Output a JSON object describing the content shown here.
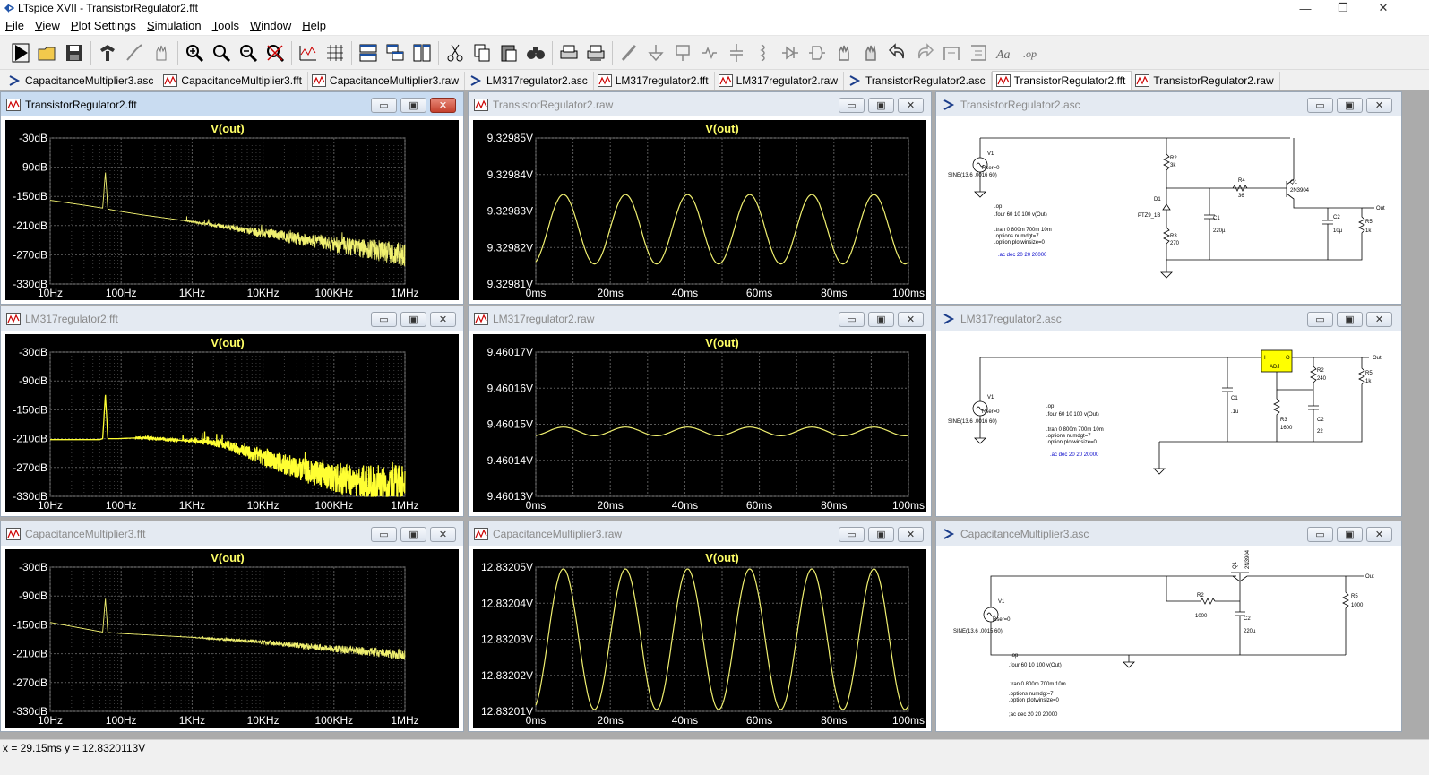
{
  "window": {
    "title": "LTspice XVII - TransistorRegulator2.fft",
    "minimize": "—",
    "maximize": "❐",
    "close": "✕"
  },
  "menu": [
    {
      "label": "File",
      "underline": "F",
      "rest": "ile"
    },
    {
      "label": "View",
      "underline": "V",
      "rest": "iew"
    },
    {
      "label": "Plot Settings",
      "underline": "P",
      "rest": "lot Settings"
    },
    {
      "label": "Simulation",
      "underline": "S",
      "rest": "imulation"
    },
    {
      "label": "Tools",
      "underline": "T",
      "rest": "ools"
    },
    {
      "label": "Window",
      "underline": "W",
      "rest": "indow"
    },
    {
      "label": "Help",
      "underline": "H",
      "rest": "elp"
    }
  ],
  "toolbar": [
    "run-icon",
    "open-icon",
    "save-icon",
    "control-panel-icon",
    "probe-icon",
    "pan-hand-icon",
    "zoom-in-icon",
    "zoom-box-icon",
    "zoom-out-icon",
    "zoom-fit-icon",
    "autorange-icon",
    "grid-icon",
    "tile-horizontal-icon",
    "cascade-icon",
    "tile-vertical-icon",
    "cut-icon",
    "copy-icon",
    "paste-icon",
    "find-icon",
    "print-icon",
    "print-setup-icon",
    "wire-icon",
    "ground-icon",
    "label-net-icon",
    "resistor-icon",
    "capacitor-icon",
    "inductor-icon",
    "diode-icon",
    "component-icon",
    "move-icon",
    "drag-icon",
    "undo-icon",
    "redo-icon",
    "rotate-icon",
    "mirror-icon",
    "text-icon",
    "spice-directive-icon"
  ],
  "tabs": [
    {
      "label": "CapacitanceMultiplier3.asc",
      "kind": "asc",
      "active": false
    },
    {
      "label": "CapacitanceMultiplier3.fft",
      "kind": "plot",
      "active": false
    },
    {
      "label": "CapacitanceMultiplier3.raw",
      "kind": "plot",
      "active": false
    },
    {
      "label": "LM317regulator2.asc",
      "kind": "asc",
      "active": false
    },
    {
      "label": "LM317regulator2.fft",
      "kind": "plot",
      "active": false
    },
    {
      "label": "LM317regulator2.raw",
      "kind": "plot",
      "active": false
    },
    {
      "label": "TransistorRegulator2.asc",
      "kind": "asc",
      "active": false
    },
    {
      "label": "TransistorRegulator2.fft",
      "kind": "plot",
      "active": true
    },
    {
      "label": "TransistorRegulator2.raw",
      "kind": "plot",
      "active": false
    }
  ],
  "windows": {
    "w11": {
      "title": "TransistorRegulator2.fft"
    },
    "w12": {
      "title": "TransistorRegulator2.raw"
    },
    "w13": {
      "title": "TransistorRegulator2.asc"
    },
    "w21": {
      "title": "LM317regulator2.fft"
    },
    "w22": {
      "title": "LM317regulator2.raw"
    },
    "w23": {
      "title": "LM317regulator2.asc"
    },
    "w31": {
      "title": "CapacitanceMultiplier3.fft"
    },
    "w32": {
      "title": "CapacitanceMultiplier3.raw"
    },
    "w33": {
      "title": "CapacitanceMultiplier3.asc"
    }
  },
  "colors": {
    "trace": "#f0f070",
    "trace_bright": "#ffff33",
    "grid": "#5a5a5a",
    "axis_text": "#ffffff",
    "trace_label": "#ffff66",
    "schematic_blue": "#0000c8"
  },
  "chart_data": [
    {
      "type": "line",
      "title": "V(out)",
      "window": "TransistorRegulator2.fft",
      "xscale": "log",
      "xlim": [
        "10Hz",
        "1MHz"
      ],
      "x_ticks": [
        "10Hz",
        "100Hz",
        "1KHz",
        "10KHz",
        "100KHz",
        "1MHz"
      ],
      "ylim": [
        -330,
        -30
      ],
      "y_ticks": [
        "-30dB",
        "-90dB",
        "-150dB",
        "-210dB",
        "-270dB",
        "-330dB"
      ],
      "series": [
        {
          "name": "V(out)",
          "x": [
            10,
            30,
            55,
            60,
            65,
            90,
            200,
            1000,
            5000,
            20000,
            100000,
            300000,
            1000000
          ],
          "y": [
            -158,
            -168,
            -174,
            -100,
            -176,
            -180,
            -188,
            -202,
            -218,
            -232,
            -248,
            -258,
            -270
          ]
        }
      ]
    },
    {
      "type": "line",
      "title": "V(out)",
      "window": "TransistorRegulator2.raw",
      "xlim": [
        0,
        100
      ],
      "x_ticks": [
        "0ms",
        "20ms",
        "40ms",
        "60ms",
        "80ms",
        "100ms"
      ],
      "ylim": [
        9.32981,
        9.32985
      ],
      "y_ticks": [
        "9.32985V",
        "9.32984V",
        "9.32983V",
        "9.32982V",
        "9.32981V"
      ],
      "series": [
        {
          "name": "V(out)",
          "waveform": "sine",
          "frequency_hz": 60,
          "center": 9.329825,
          "amplitude": 9.5e-06
        }
      ]
    },
    {
      "type": "line",
      "title": "V(out)",
      "window": "LM317regulator2.fft",
      "xscale": "log",
      "xlim": [
        "10Hz",
        "1MHz"
      ],
      "x_ticks": [
        "10Hz",
        "100Hz",
        "1KHz",
        "10KHz",
        "100KHz",
        "1MHz"
      ],
      "ylim": [
        -330,
        -30
      ],
      "y_ticks": [
        "-30dB",
        "-90dB",
        "-150dB",
        "-210dB",
        "-270dB",
        "-330dB"
      ],
      "series": [
        {
          "name": "V(out)",
          "x": [
            10,
            50,
            55,
            60,
            65,
            90,
            200,
            1000,
            3000,
            10000,
            50000,
            200000,
            1000000
          ],
          "y": [
            -212,
            -212,
            -210,
            -118,
            -210,
            -210,
            -208,
            -215,
            -222,
            -250,
            -280,
            -300,
            -310
          ]
        }
      ]
    },
    {
      "type": "line",
      "title": "V(out)",
      "window": "LM317regulator2.raw",
      "xlim": [
        0,
        100
      ],
      "x_ticks": [
        "0ms",
        "20ms",
        "40ms",
        "60ms",
        "80ms",
        "100ms"
      ],
      "ylim": [
        9.46013,
        9.46017
      ],
      "y_ticks": [
        "9.46017V",
        "9.46016V",
        "9.46015V",
        "9.46014V",
        "9.46013V"
      ],
      "series": [
        {
          "name": "V(out)",
          "waveform": "sine",
          "frequency_hz": 60,
          "center": 9.460148,
          "amplitude": 1.2e-06
        }
      ]
    },
    {
      "type": "line",
      "title": "V(out)",
      "window": "CapacitanceMultiplier3.fft",
      "xscale": "log",
      "xlim": [
        "10Hz",
        "1MHz"
      ],
      "x_ticks": [
        "10Hz",
        "100Hz",
        "1KHz",
        "10KHz",
        "100KHz",
        "1MHz"
      ],
      "ylim": [
        -330,
        -30
      ],
      "y_ticks": [
        "-30dB",
        "-90dB",
        "-150dB",
        "-210dB",
        "-270dB",
        "-330dB"
      ],
      "series": [
        {
          "name": "V(out)",
          "x": [
            10,
            30,
            55,
            60,
            65,
            100,
            1000,
            10000,
            100000,
            1000000
          ],
          "y": [
            -145,
            -158,
            -165,
            -95,
            -166,
            -168,
            -176,
            -186,
            -200,
            -212
          ]
        }
      ]
    },
    {
      "type": "line",
      "title": "V(out)",
      "window": "CapacitanceMultiplier3.raw",
      "xlim": [
        0,
        100
      ],
      "x_ticks": [
        "0ms",
        "20ms",
        "40ms",
        "60ms",
        "80ms",
        "100ms"
      ],
      "ylim": [
        12.83201,
        12.83205
      ],
      "y_ticks": [
        "12.83205V",
        "12.83204V",
        "12.83203V",
        "12.83202V",
        "12.83201V"
      ],
      "series": [
        {
          "name": "V(out)",
          "waveform": "sine",
          "frequency_hz": 60,
          "center": 12.83203,
          "amplitude": 1.95e-05
        }
      ]
    }
  ],
  "schematics": {
    "transistor": {
      "v1": "V1",
      "v1_rser": "Rser=0",
      "v1_src": "SINE(13.6 .0016 60)",
      "r2": "R2",
      "r2_val": "3k",
      "r4": "R4",
      "r4_val": "36",
      "q1": "Q1",
      "q1_val": "2N3904",
      "d1": "D1",
      "d1_val": "PTZ9_1B",
      "r3": "R3",
      "r3_val": "270",
      "c1": "C1",
      "c1_val": "220µ",
      "c2": "C2",
      "c2_val": "10µ",
      "r5": "R5",
      "r5_val": "1k",
      "out": "Out",
      "dir_op": ".op",
      "dir_four": ".four 60 10 100 v(Out)",
      "dir_tran": ".tran 0 800m 700m 10m",
      "dir_opt1": ".options numdgt=7",
      "dir_opt2": ".option plotwinsize=0",
      "dir_ac": ".ac dec 20 20 20000"
    },
    "lm317": {
      "v1": "V1",
      "v1_rser": "Rser=0",
      "v1_src": "SINE(13.6 .0016 60)",
      "u_i": "I",
      "u_o": "O",
      "u_adj": "ADJ",
      "c1": "C1",
      "c1_val": ".1u",
      "r2": "R2",
      "r2_val": "240",
      "r3": "R3",
      "r3_val": "1600",
      "c2": "C2",
      "c2_val": "22",
      "r5": "R5",
      "r5_val": "1k",
      "out": "Out",
      "dir_op": ".op",
      "dir_four": ".four 60 10 100 v(Out)",
      "dir_tran": ".tran 0 800m 700m 10m",
      "dir_opt1": ".options numdgt=7",
      "dir_opt2": ".option plotwinsize=0",
      "dir_ac": ".ac dec 20 20 20000"
    },
    "capmult": {
      "v1": "V1",
      "v1_rser": "Rser=0",
      "v1_src": "SINE(13.6 .0015 60)",
      "q1": "Q1",
      "q1_val": "2N3904",
      "r2": "R2",
      "r2_val": "1000",
      "c2": "C2",
      "c2_val": "220µ",
      "r5": "R5",
      "r5_val": "1000",
      "out": "Out",
      "dir_op": ".op",
      "dir_four": ".four 60 10 100 v(Out)",
      "dir_tran": ".tran 0 800m 700m 10m",
      "dir_opt1": ".options numdgt=7",
      "dir_opt2": ".option plotwinsize=0",
      "dir_ac": ";ac dec 20 20 20000"
    }
  },
  "status": {
    "text": "x = 29.15ms    y = 12.8320113V"
  }
}
